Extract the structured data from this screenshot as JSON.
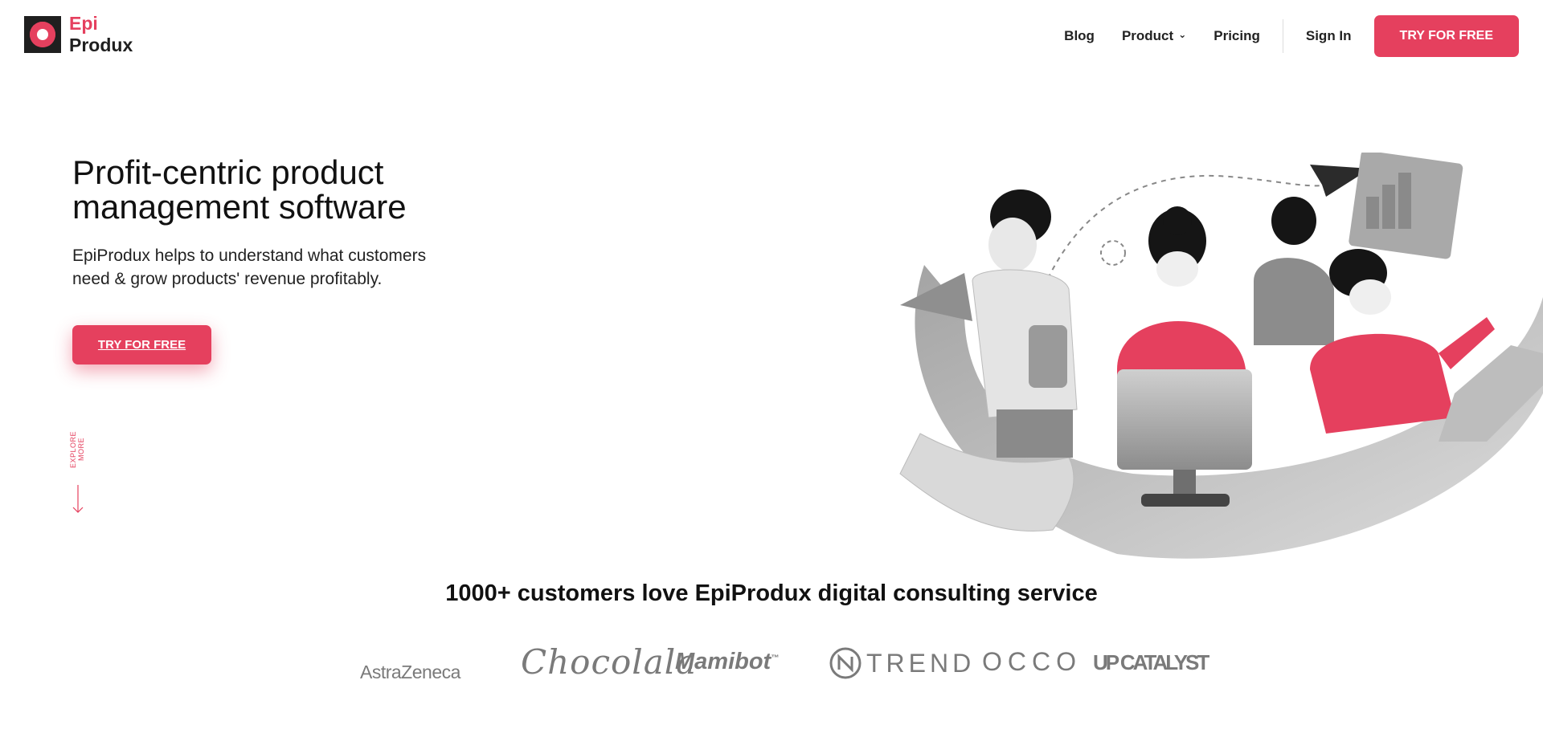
{
  "brand": {
    "line1": "Epi",
    "line2": "Produx"
  },
  "nav": {
    "blog": "Blog",
    "product": "Product",
    "pricing": "Pricing",
    "sign_in": "Sign In",
    "cta": "TRY FOR FREE"
  },
  "hero": {
    "title_line1": "Profit-centric product",
    "title_line2": "management software",
    "subtitle_line1": "EpiProdux helps to understand what customers",
    "subtitle_line2": "need & grow products' revenue profitably.",
    "cta": "TRY FOR FREE",
    "explore": "EXPLORE MORE"
  },
  "customers": {
    "title": "1000+ customers love EpiProdux digital consulting service",
    "logos": [
      "AstraZeneca",
      "Chocolala",
      "Mamibot",
      "TREND",
      "OCCO",
      "UP CATALYST"
    ]
  },
  "colors": {
    "accent": "#e5405e",
    "dark": "#1f1f1f",
    "gray": "#7a7a7a"
  }
}
